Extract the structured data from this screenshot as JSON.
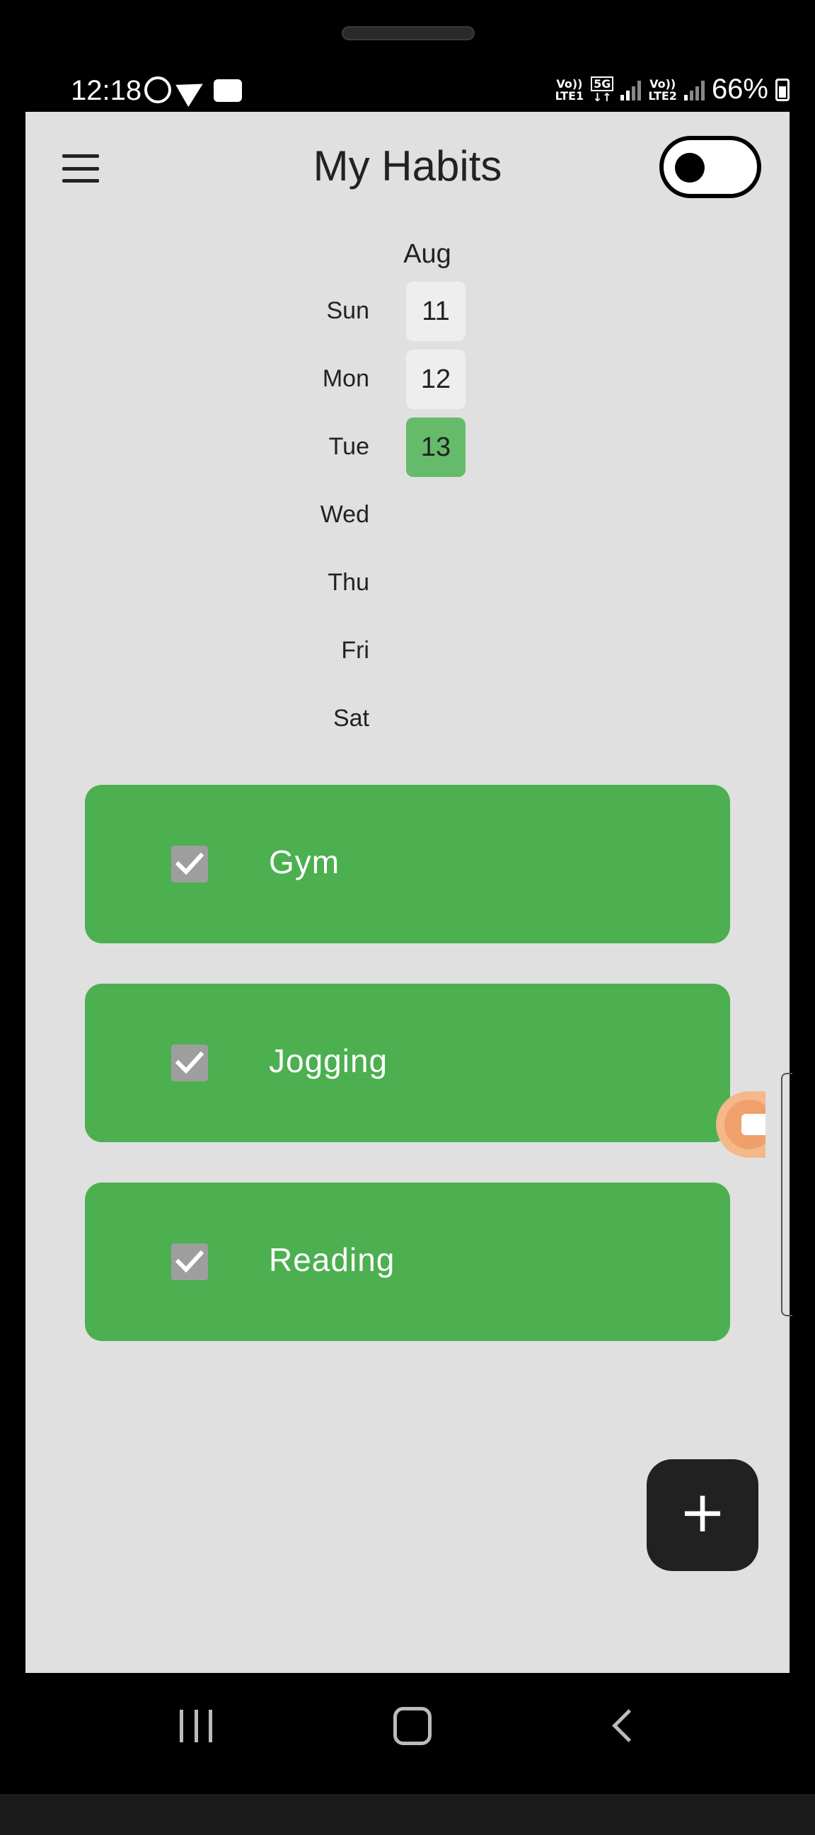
{
  "status_bar": {
    "time": "12:18",
    "sim1_label_top": "Vo))",
    "sim1_label_bottom": "LTE1",
    "net_label_top": "5G",
    "net_label_bottom": "↓↑",
    "sim2_label_top": "Vo))",
    "sim2_label_bottom": "LTE2",
    "battery": "66%",
    "icons": [
      "whatsapp-icon",
      "telegram-icon",
      "video-icon"
    ]
  },
  "app_bar": {
    "title": "My Habits",
    "menu_icon": "hamburger-menu-icon",
    "theme_toggle_on": false
  },
  "calendar": {
    "month": "Aug",
    "days": [
      {
        "name": "Sun",
        "num": "11",
        "today": false
      },
      {
        "name": "Mon",
        "num": "12",
        "today": false
      },
      {
        "name": "Tue",
        "num": "13",
        "today": true
      },
      {
        "name": "Wed",
        "num": ""
      },
      {
        "name": "Thu",
        "num": ""
      },
      {
        "name": "Fri",
        "num": ""
      },
      {
        "name": "Sat",
        "num": ""
      }
    ]
  },
  "habits": [
    {
      "name": "Gym",
      "checked": true
    },
    {
      "name": "Jogging",
      "checked": true
    },
    {
      "name": "Reading",
      "checked": true
    }
  ],
  "fab": {
    "label": "+"
  },
  "colors": {
    "background": "#e0e0e0",
    "habit_card": "#4caf50",
    "today": "#66bb6a",
    "fab": "#212121"
  }
}
